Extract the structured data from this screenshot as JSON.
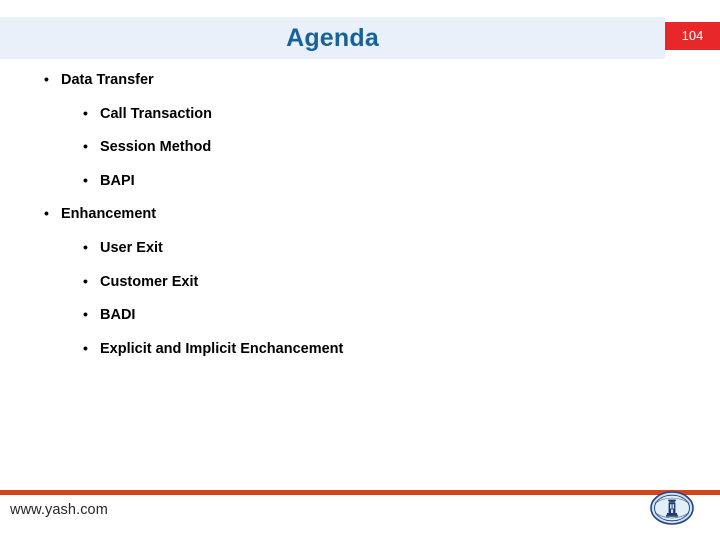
{
  "slide": {
    "title": "Agenda",
    "slide_number": "104",
    "title_color": "#16639c",
    "header_band_color": "#eaf0f9",
    "badge_color": "#e8272a",
    "footer_rule_color": "#d4451f",
    "text_color": "#000000"
  },
  "bullets": [
    {
      "level": 1,
      "marker": "•",
      "label": "Data Transfer"
    },
    {
      "level": 2,
      "marker": "•",
      "label": "Call Transaction"
    },
    {
      "level": 2,
      "marker": "•",
      "label": "Session Method"
    },
    {
      "level": 2,
      "marker": "•",
      "label": "BAPI"
    },
    {
      "level": 1,
      "marker": "•",
      "label": "Enhancement"
    },
    {
      "level": 2,
      "marker": "•",
      "label": "User Exit"
    },
    {
      "level": 2,
      "marker": "•",
      "label": "Customer Exit"
    },
    {
      "level": 2,
      "marker": "•",
      "label": "BADI"
    },
    {
      "level": 2,
      "marker": "•",
      "label": "Explicit and Implicit Enchancement"
    }
  ],
  "footer": {
    "url": "www.yash.com",
    "logo_name": "yash-seal-logo"
  }
}
